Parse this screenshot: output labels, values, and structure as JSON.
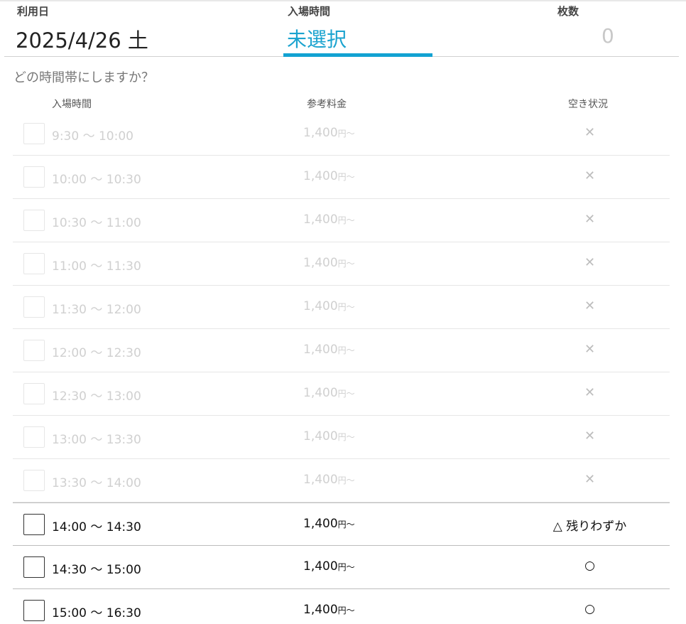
{
  "header": {
    "date_label": "利用日",
    "date_value": "2025/4/26 土",
    "time_label": "入場時間",
    "time_value": "未選択",
    "qty_label": "枚数",
    "qty_value": "0"
  },
  "question": "どの時間帯にしますか？",
  "table_headers": {
    "time": "入場時間",
    "price": "参考料金",
    "status": "空き状況"
  },
  "slots": [
    {
      "time": "9:30 ～ 10:00",
      "price": "1,400",
      "yen": "円～",
      "status": "✕",
      "available": false
    },
    {
      "time": "10:00 ～ 10:30",
      "price": "1,400",
      "yen": "円～",
      "status": "✕",
      "available": false
    },
    {
      "time": "10:30 ～ 11:00",
      "price": "1,400",
      "yen": "円～",
      "status": "✕",
      "available": false
    },
    {
      "time": "11:00 ～ 11:30",
      "price": "1,400",
      "yen": "円～",
      "status": "✕",
      "available": false
    },
    {
      "time": "11:30 ～ 12:00",
      "price": "1,400",
      "yen": "円～",
      "status": "✕",
      "available": false
    },
    {
      "time": "12:00 ～ 12:30",
      "price": "1,400",
      "yen": "円～",
      "status": "✕",
      "available": false
    },
    {
      "time": "12:30 ～ 13:00",
      "price": "1,400",
      "yen": "円～",
      "status": "✕",
      "available": false
    },
    {
      "time": "13:00 ～ 13:30",
      "price": "1,400",
      "yen": "円～",
      "status": "✕",
      "available": false
    },
    {
      "time": "13:30 ～ 14:00",
      "price": "1,400",
      "yen": "円～",
      "status": "✕",
      "available": false
    },
    {
      "time": "14:00 ～ 14:30",
      "price": "1,400",
      "yen": "円～",
      "status": "△ 残りわずか",
      "available": true
    },
    {
      "time": "14:30 ～ 15:00",
      "price": "1,400",
      "yen": "円～",
      "status": "○",
      "available": true
    },
    {
      "time": "15:00 ～ 16:30",
      "price": "1,400",
      "yen": "円～",
      "status": "○",
      "available": true
    }
  ],
  "colors": {
    "accent": "#12a2d2",
    "disabled_text": "#d0d0d0"
  }
}
